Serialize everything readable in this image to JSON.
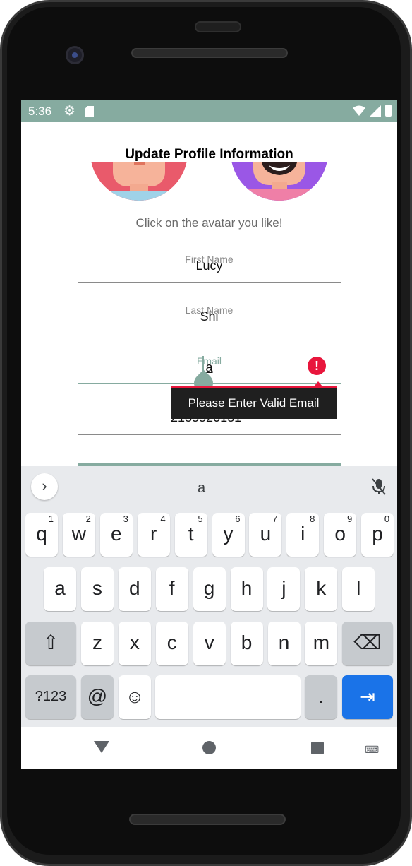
{
  "status_bar": {
    "time": "5:36",
    "background": "#86aba0"
  },
  "screen": {
    "title": "Update Profile Information",
    "avatar_hint": "Click on the avatar you like!",
    "fields": {
      "first_name": {
        "label": "First Name",
        "value": "Lucy"
      },
      "last_name": {
        "label": "Last Name",
        "value": "Shi"
      },
      "email": {
        "label": "Email",
        "value": "a"
      },
      "phone": {
        "value": "2135520131"
      }
    },
    "error_tooltip": "Please Enter Valid Email",
    "accent_color": "#86aba0",
    "error_color": "#e8163c"
  },
  "keyboard": {
    "suggestion": "a",
    "row1": [
      {
        "key": "q",
        "sup": "1"
      },
      {
        "key": "w",
        "sup": "2"
      },
      {
        "key": "e",
        "sup": "3"
      },
      {
        "key": "r",
        "sup": "4"
      },
      {
        "key": "t",
        "sup": "5"
      },
      {
        "key": "y",
        "sup": "6"
      },
      {
        "key": "u",
        "sup": "7"
      },
      {
        "key": "i",
        "sup": "8"
      },
      {
        "key": "o",
        "sup": "9"
      },
      {
        "key": "p",
        "sup": "0"
      }
    ],
    "row2": [
      "a",
      "s",
      "d",
      "f",
      "g",
      "h",
      "j",
      "k",
      "l"
    ],
    "row3": [
      "z",
      "x",
      "c",
      "v",
      "b",
      "n",
      "m"
    ],
    "symbols_key": "?123",
    "at_key": "@",
    "period_key": "."
  }
}
